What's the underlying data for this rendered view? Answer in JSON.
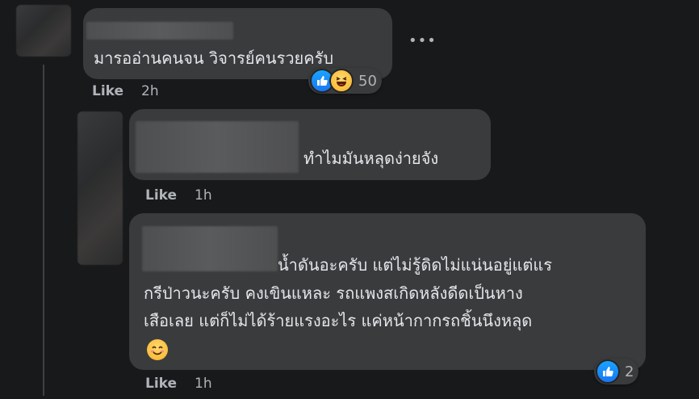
{
  "comments": [
    {
      "text": "มารออ่านคนจน วิจารย์คนรวยครับ",
      "like_label": "Like",
      "time": "2h",
      "reaction_count": "50",
      "more_label": "•••"
    },
    {
      "text": "ทำไมมันหลุดง่ายจัง",
      "like_label": "Like",
      "time": "1h"
    },
    {
      "lines": [
        "น้ำดันอะครับ แต่ไม่รู้ดิดไม่แน่นอยู่แต่แร",
        "กรีป่าวนะครับ คงเขินแหละ รถแพงสเกิดหลังดีดเป็นหาง",
        "เสือเลย แต่ก็ไม่ได้ร้ายแรงอะไร แค่หน้ากากรถชิ้นนึงหลุด"
      ],
      "like_label": "Like",
      "time": "1h",
      "reaction_count": "2"
    }
  ],
  "colors": {
    "background": "#18191a",
    "bubble": "#3a3b3c",
    "like_blue": "#1877f2"
  },
  "icons": [
    "like-reaction-icon",
    "haha-reaction-icon",
    "smile-emoji-icon",
    "more-options-icon"
  ]
}
